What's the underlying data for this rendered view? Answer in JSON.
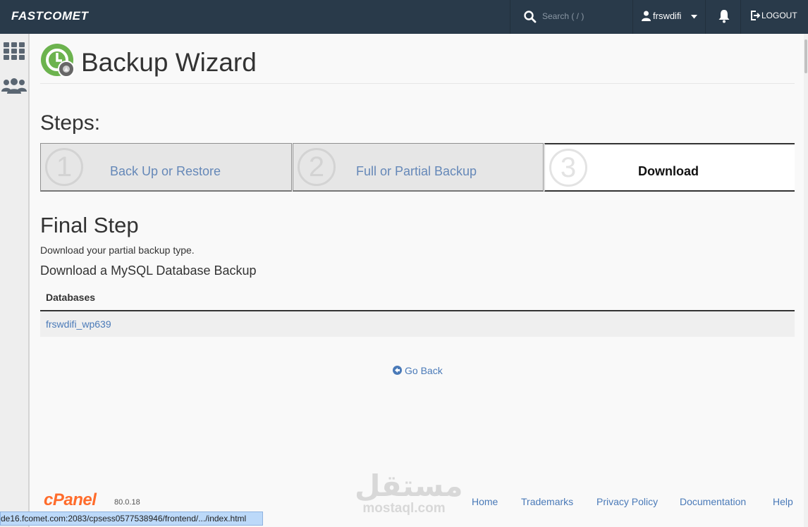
{
  "topbar": {
    "logo": "FASTCOMET",
    "search_placeholder": "Search ( / )",
    "username": "frswdifi",
    "logout_label": "LOGOUT"
  },
  "page": {
    "title": "Backup Wizard",
    "steps_heading": "Steps:"
  },
  "steps": [
    {
      "number": "1",
      "label": "Back Up or Restore",
      "active": false
    },
    {
      "number": "2",
      "label": "Full or Partial Backup",
      "active": false
    },
    {
      "number": "3",
      "label": "Download",
      "active": true
    }
  ],
  "final": {
    "heading": "Final Step",
    "description": "Download your partial backup type.",
    "subheading": "Download a MySQL Database Backup",
    "table_header": "Databases",
    "databases": [
      "frswdifi_wp639"
    ],
    "go_back": "Go Back"
  },
  "footer": {
    "cpanel_logo": "cPanel",
    "version": "80.0.18",
    "watermark_arabic": "مستقل",
    "watermark_latin": "mostaql.com",
    "links": [
      "Home",
      "Trademarks",
      "Privacy Policy",
      "Documentation",
      "Help"
    ]
  },
  "status_bar_url": "de16.fcomet.com:2083/cpsess0577538946/frontend/.../index.html",
  "colors": {
    "topbar": "#293a4a",
    "link": "#4a7ab8",
    "wizard_icon_green": "#6cb34e",
    "cpanel_orange": "#ff6c2c"
  },
  "icons": [
    "search-icon",
    "user-icon",
    "caret-down-icon",
    "bell-icon",
    "logout-icon",
    "apps-grid-icon",
    "users-icon",
    "backup-wizard-icon",
    "arrow-circle-left-icon"
  ]
}
